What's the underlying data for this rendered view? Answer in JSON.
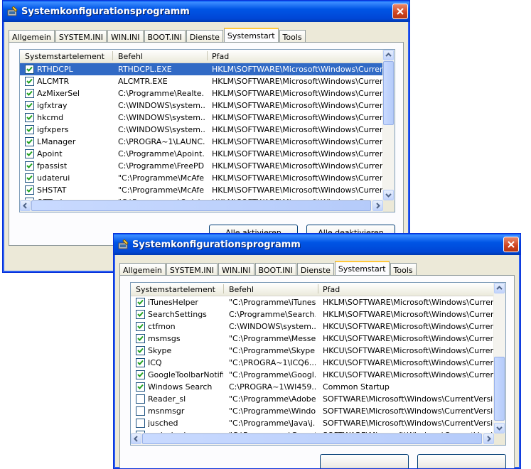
{
  "windows": [
    {
      "title": "Systemkonfigurationsprogramm",
      "tabs": [
        "Allgemein",
        "SYSTEM.INI",
        "WIN.INI",
        "BOOT.INI",
        "Dienste",
        "Systemstart",
        "Tools"
      ],
      "active_tab": "Systemstart",
      "columns": [
        "Systemstartelement",
        "Befehl",
        "Pfad"
      ],
      "rows": [
        {
          "name": "RTHDCPL",
          "command": "RTHDCPL.EXE",
          "path": "HKLM\\SOFTWARE\\Microsoft\\Windows\\CurrentVer...",
          "checked": true,
          "selected": true
        },
        {
          "name": "ALCMTR",
          "command": "ALCMTR.EXE",
          "path": "HKLM\\SOFTWARE\\Microsoft\\Windows\\CurrentVer...",
          "checked": true
        },
        {
          "name": "AzMixerSel",
          "command": "C:\\Programme\\Realte...",
          "path": "HKLM\\SOFTWARE\\Microsoft\\Windows\\CurrentVer...",
          "checked": true
        },
        {
          "name": "igfxtray",
          "command": "C:\\WINDOWS\\system...",
          "path": "HKLM\\SOFTWARE\\Microsoft\\Windows\\CurrentVer...",
          "checked": true
        },
        {
          "name": "hkcmd",
          "command": "C:\\WINDOWS\\system...",
          "path": "HKLM\\SOFTWARE\\Microsoft\\Windows\\CurrentVer...",
          "checked": true
        },
        {
          "name": "igfxpers",
          "command": "C:\\WINDOWS\\system...",
          "path": "HKLM\\SOFTWARE\\Microsoft\\Windows\\CurrentVer...",
          "checked": true
        },
        {
          "name": "LManager",
          "command": "C:\\PROGRA~1\\LAUNC...",
          "path": "HKLM\\SOFTWARE\\Microsoft\\Windows\\CurrentVer...",
          "checked": true
        },
        {
          "name": "Apoint",
          "command": "C:\\Programme\\Apoint...",
          "path": "HKLM\\SOFTWARE\\Microsoft\\Windows\\CurrentVer...",
          "checked": true
        },
        {
          "name": "fpassist",
          "command": "C:\\Programme\\FreePD...",
          "path": "HKLM\\SOFTWARE\\Microsoft\\Windows\\CurrentVer...",
          "checked": true
        },
        {
          "name": "udaterui",
          "command": "\"C:\\Programme\\McAfe...",
          "path": "HKLM\\SOFTWARE\\Microsoft\\Windows\\CurrentVer...",
          "checked": true
        },
        {
          "name": "SHSTAT",
          "command": "\"C:\\Programme\\McAfe...",
          "path": "HKLM\\SOFTWARE\\Microsoft\\Windows\\CurrentVer...",
          "checked": true
        },
        {
          "name": "OTTask",
          "command": "\"C:\\Programme\\Quick...",
          "path": "HKLM\\SOFTWARE\\Microsoft\\Windows\\CurrentVer...",
          "checked": true
        }
      ],
      "buttons": {
        "enable_all_pre": "Alle a",
        "enable_all_key": "k",
        "enable_all_post": "tivieren",
        "disable_all_pre": "Alle de",
        "disable_all_key": "a",
        "disable_all_post": "ktivieren"
      }
    },
    {
      "title": "Systemkonfigurationsprogramm",
      "tabs": [
        "Allgemein",
        "SYSTEM.INI",
        "WIN.INI",
        "BOOT.INI",
        "Dienste",
        "Systemstart",
        "Tools"
      ],
      "active_tab": "Systemstart",
      "columns": [
        "Systemstartelement",
        "Befehl",
        "Pfad"
      ],
      "rows": [
        {
          "name": "iTunesHelper",
          "command": "\"C:\\Programme\\iTunes...",
          "path": "HKLM\\SOFTWARE\\Microsoft\\Windows\\CurrentVer...",
          "checked": true
        },
        {
          "name": "SearchSettings",
          "command": "C:\\Programme\\Search...",
          "path": "HKLM\\SOFTWARE\\Microsoft\\Windows\\CurrentVer...",
          "checked": true
        },
        {
          "name": "ctfmon",
          "command": "C:\\WINDOWS\\system...",
          "path": "HKCU\\SOFTWARE\\Microsoft\\Windows\\CurrentVer...",
          "checked": true
        },
        {
          "name": "msmsgs",
          "command": "\"C:\\Programme\\Messe...",
          "path": "HKCU\\SOFTWARE\\Microsoft\\Windows\\CurrentVer...",
          "checked": true
        },
        {
          "name": "Skype",
          "command": "\"C:\\Programme\\Skype...",
          "path": "HKCU\\SOFTWARE\\Microsoft\\Windows\\CurrentVer...",
          "checked": true
        },
        {
          "name": "ICQ",
          "command": "\"C:\\PROGRA~1\\ICQ6...",
          "path": "HKCU\\SOFTWARE\\Microsoft\\Windows\\CurrentVer...",
          "checked": true
        },
        {
          "name": "GoogleToolbarNotifier",
          "command": "\"C:\\Programme\\Googl...",
          "path": "HKCU\\SOFTWARE\\Microsoft\\Windows\\CurrentVer...",
          "checked": true
        },
        {
          "name": "Windows Search",
          "command": "C:\\PROGRA~1\\WI459...",
          "path": "Common Startup",
          "checked": true
        },
        {
          "name": "Reader_sl",
          "command": "\"C:\\Programme\\Adobe...",
          "path": "SOFTWARE\\Microsoft\\Windows\\CurrentVersion\\Ru",
          "checked": false
        },
        {
          "name": "msnmsgr",
          "command": "\"C:\\Programme\\Windo...",
          "path": "SOFTWARE\\Microsoft\\Windows\\CurrentVersion\\Ru",
          "checked": false
        },
        {
          "name": "jusched",
          "command": "\"C:\\Programme\\Java\\j...",
          "path": "SOFTWARE\\Microsoft\\Windows\\CurrentVersion\\Ru",
          "checked": false
        },
        {
          "name": "realsched",
          "command": "\"C:\\Programme\\Gemei...",
          "path": "SOFTWARE\\Microsoft\\Windows\\CurrentVersion\\Ru",
          "checked": false
        }
      ]
    }
  ],
  "colors": {
    "titlebar": "#0055e5",
    "window_bg": "#ece9d8",
    "selection": "#316ac5",
    "close_button": "#d0431f",
    "tab_accent": "#ffc83c"
  },
  "icons": [
    "app-icon",
    "close-icon",
    "checkbox-check-icon",
    "scroll-up-icon",
    "scroll-down-icon",
    "scroll-left-icon",
    "scroll-right-icon"
  ]
}
